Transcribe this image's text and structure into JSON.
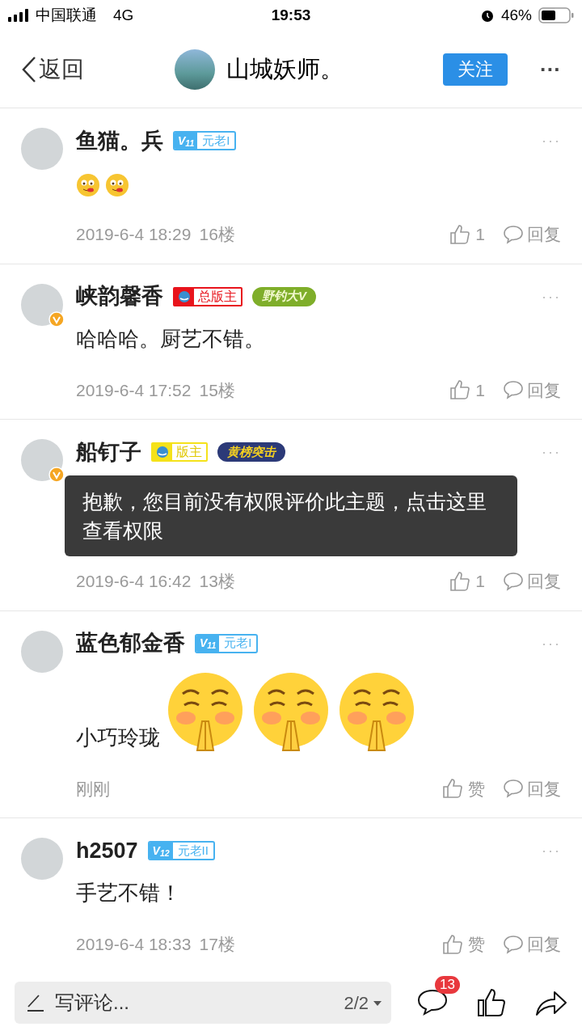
{
  "status_bar": {
    "carrier": "中国联通",
    "network": "4G",
    "time": "19:53",
    "battery": "46%"
  },
  "header": {
    "back": "返回",
    "title": "山城妖师。",
    "follow": "关注",
    "more": "···"
  },
  "posts": [
    {
      "name": "鱼猫。兵",
      "verified": false,
      "badges": [
        {
          "kind": "level",
          "level": "V$_{11}$",
          "text": "元老I"
        }
      ],
      "content": [
        {
          "kind": "tongue"
        },
        {
          "kind": "tongue"
        }
      ],
      "time": "2019-6-4 18:29",
      "floor": "16楼",
      "likes": "1",
      "reply": "回复"
    },
    {
      "name": "峡韵馨香",
      "verified": true,
      "badges": [
        {
          "kind": "role",
          "text": "总版主",
          "color": "#e8141c"
        },
        {
          "kind": "medal",
          "text": "野钓大V",
          "color": "#7fae2a"
        }
      ],
      "content": [
        {
          "kind": "text",
          "text": "哈哈哈。厨艺不错。"
        }
      ],
      "time": "2019-6-4 17:52",
      "floor": "15楼",
      "likes": "1",
      "reply": "回复"
    },
    {
      "name": "船钉子",
      "verified": true,
      "badges": [
        {
          "kind": "role",
          "text": "版主",
          "color": "#f5e21a"
        },
        {
          "kind": "medal",
          "text": "黄榜突击",
          "color": "#2c3a78"
        }
      ],
      "time": "2019-6-4 16:42",
      "floor": "13楼",
      "likes": "1",
      "reply": "回复"
    },
    {
      "name": "蓝色郁金香",
      "verified": false,
      "badges": [
        {
          "kind": "level",
          "level": "V$_{11}$",
          "text": "元老I"
        }
      ],
      "content": [
        {
          "kind": "text",
          "text": "小巧玲珑"
        },
        {
          "kind": "pray"
        },
        {
          "kind": "pray"
        },
        {
          "kind": "pray"
        }
      ],
      "time": "刚刚",
      "likes": "赞",
      "reply": "回复"
    },
    {
      "name": "h2507",
      "verified": false,
      "badges": [
        {
          "kind": "level",
          "level": "V$_{12}$",
          "text": "元老II"
        }
      ],
      "content": [
        {
          "kind": "text",
          "text": "手艺不错！"
        }
      ],
      "time": "2019-6-4 18:33",
      "floor": "17楼",
      "likes": "赞",
      "reply": "回复"
    }
  ],
  "toast": "抱歉，您目前没有权限评价此主题，点击这里查看权限",
  "bottom_bar": {
    "placeholder": "写评论...",
    "page": "2/2",
    "comment_count": "13"
  }
}
